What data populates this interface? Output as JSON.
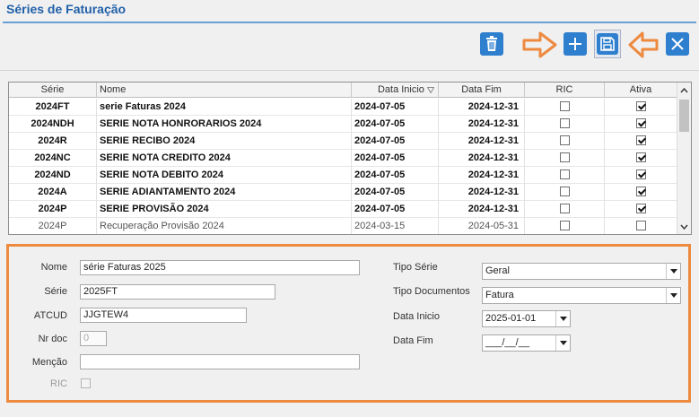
{
  "page": {
    "title": "Séries de Faturação"
  },
  "colors": {
    "accent": "#1f5fa8",
    "highlight": "#ed8a3f",
    "toolbar_blue": "#2f7fcf"
  },
  "toolbar": {
    "buttons": [
      {
        "name": "delete-button",
        "icon": "trash-icon"
      },
      {
        "name": "add-button",
        "icon": "plus-icon"
      },
      {
        "name": "save-button",
        "icon": "floppy-disk-icon"
      },
      {
        "name": "close-button",
        "icon": "close-icon"
      }
    ],
    "annotations": [
      "arrow-right-icon",
      "arrow-left-icon"
    ]
  },
  "grid": {
    "columns": [
      "Série",
      "Nome",
      "Data Inicio",
      "Data Fim",
      "RIC",
      "Ativa"
    ],
    "sort_icon": "sort-desc-icon",
    "rows": [
      {
        "serie": "2024FT",
        "nome": "serie Faturas 2024",
        "inicio": "2024-07-05",
        "fim": "2024-12-31",
        "ric": false,
        "ativa": true,
        "bold": true
      },
      {
        "serie": "2024NDH",
        "nome": "SERIE NOTA HONRORARIOS 2024",
        "inicio": "2024-07-05",
        "fim": "2024-12-31",
        "ric": false,
        "ativa": true,
        "bold": true
      },
      {
        "serie": "2024R",
        "nome": "SERIE RECIBO 2024",
        "inicio": "2024-07-05",
        "fim": "2024-12-31",
        "ric": false,
        "ativa": true,
        "bold": true
      },
      {
        "serie": "2024NC",
        "nome": "SERIE NOTA CREDITO 2024",
        "inicio": "2024-07-05",
        "fim": "2024-12-31",
        "ric": false,
        "ativa": true,
        "bold": true
      },
      {
        "serie": "2024ND",
        "nome": "SERIE NOTA DEBITO 2024",
        "inicio": "2024-07-05",
        "fim": "2024-12-31",
        "ric": false,
        "ativa": true,
        "bold": true
      },
      {
        "serie": "2024A",
        "nome": "SERIE ADIANTAMENTO 2024",
        "inicio": "2024-07-05",
        "fim": "2024-12-31",
        "ric": false,
        "ativa": true,
        "bold": true
      },
      {
        "serie": "2024P",
        "nome": "SERIE PROVISÃO 2024",
        "inicio": "2024-07-05",
        "fim": "2024-12-31",
        "ric": false,
        "ativa": true,
        "bold": true
      },
      {
        "serie": "2024P",
        "nome": "Recuperação Provisão 2024",
        "inicio": "2024-03-15",
        "fim": "2024-05-31",
        "ric": false,
        "ativa": false,
        "bold": false
      }
    ]
  },
  "form": {
    "nome": {
      "label": "Nome",
      "value": "série Faturas 2025"
    },
    "serie": {
      "label": "Série",
      "value": "2025FT"
    },
    "atcud": {
      "label": "ATCUD",
      "value": "JJGTEW4"
    },
    "nrdoc": {
      "label": "Nr doc",
      "value": "0"
    },
    "mencao": {
      "label": "Menção",
      "value": ""
    },
    "ric": {
      "label": "RIC",
      "checked": false
    },
    "tipo_serie": {
      "label": "Tipo Série",
      "value": "Geral"
    },
    "tipo_documentos": {
      "label": "Tipo Documentos",
      "value": "Fatura"
    },
    "data_inicio": {
      "label": "Data Inicio",
      "value": "2025-01-01"
    },
    "data_fim": {
      "label": "Data Fim",
      "value": "___/__/__"
    }
  }
}
